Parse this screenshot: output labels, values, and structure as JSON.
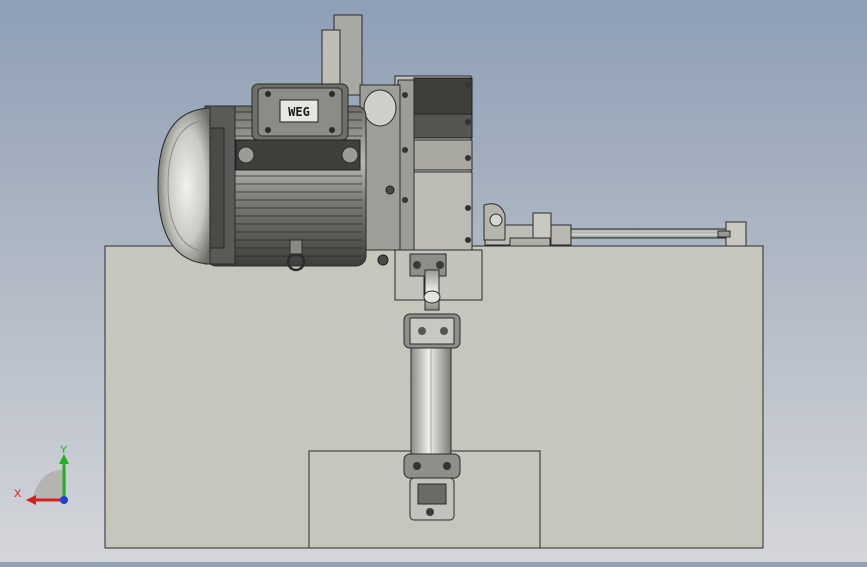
{
  "viewport": {
    "background_top": "#8e9fb6",
    "background_bottom": "#d4d6da"
  },
  "model": {
    "base_color": "#c6c6bd",
    "edge_color": "#2a2a2a",
    "metal_color": "#8c8c86",
    "dark_metal": "#3c3c3a",
    "motor_nameplate_text": "WEG"
  },
  "triad": {
    "x_label": "X",
    "y_label": "Y",
    "x_color": "#d42020",
    "y_color": "#20b020",
    "z_color": "#2040d0"
  }
}
